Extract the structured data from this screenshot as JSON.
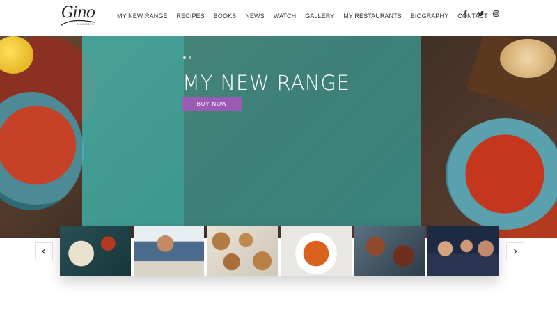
{
  "brand": {
    "logo_script": "Gino",
    "logo_sub": "D'ACAMPO"
  },
  "nav": {
    "items": [
      {
        "label": "MY NEW RANGE"
      },
      {
        "label": "RECIPES"
      },
      {
        "label": "BOOKS"
      },
      {
        "label": "NEWS"
      },
      {
        "label": "WATCH"
      },
      {
        "label": "GALLERY"
      },
      {
        "label": "MY RESTAURANTS"
      },
      {
        "label": "BIOGRAPHY"
      },
      {
        "label": "CONTACT"
      }
    ],
    "social": [
      "facebook-icon",
      "twitter-icon",
      "instagram-icon"
    ]
  },
  "hero": {
    "title": "MY NEW RANGE",
    "button_label": "BUY NOW",
    "slide_count": 2,
    "active_slide": 1,
    "overlay_color": "#40c4be",
    "button_color": "#9b5bb4"
  },
  "carousel": {
    "prev_icon": "chevron-left-icon",
    "next_icon": "chevron-right-icon",
    "thumbnails": [
      {
        "subject": "stuffed-pasta-plate"
      },
      {
        "subject": "gino-portrait-dining"
      },
      {
        "subject": "pastries-tray"
      },
      {
        "subject": "pasta-bowl"
      },
      {
        "subject": "platter-spread"
      },
      {
        "subject": "group-photo"
      }
    ]
  }
}
